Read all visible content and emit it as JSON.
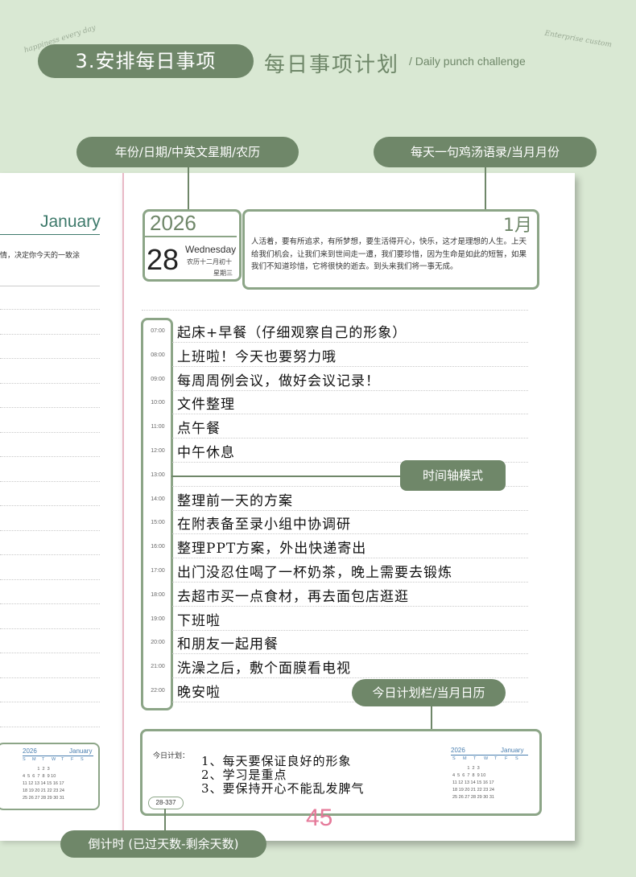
{
  "header": {
    "step_label": "3.安排每日事项",
    "title": "每日事项计划",
    "subtitle": "/ Daily punch challenge",
    "deco_left": "happiness every day",
    "deco_right": "Enterprise custom"
  },
  "callouts": {
    "date_info": "年份/日期/中英文星期/农历",
    "quote_month": "每天一句鸡汤语录/当月月份",
    "timeline": "时间轴模式",
    "plan_calendar": "今日计划栏/当月日历",
    "countdown": "倒计时 (已过天数-剩余天数)"
  },
  "left_page": {
    "month": "January",
    "text_fragment": "情，决定你今天的一致涂",
    "calendar": {
      "year": "2026",
      "month": "January",
      "weekdays": [
        "S",
        "M",
        "T",
        "W",
        "T",
        "F",
        "S"
      ],
      "rows": [
        "            1  2  3",
        "4  5  6  7  8  9 10",
        "11 12 13 14 15 16 17",
        "18 19 20 21 22 23 24",
        "25 26 27 28 29 30 31"
      ]
    }
  },
  "date_block": {
    "year": "2026",
    "day": "28",
    "weekday_en": "Wednesday",
    "lunar": "农历十二月初十",
    "weekday_cn": "星期三"
  },
  "quote_block": {
    "month": "1月",
    "text": "人活着，要有所追求，有所梦想，要生活得开心，快乐，这才是理想的人生。上天给我们机会，让我们来到世间走一遭，我们要珍惜，因为生命是如此的短暂，如果我们不知道珍惜，它将很快的逝去。到头来我们将一事无成。"
  },
  "timeline": [
    {
      "time": "07:00",
      "entry": "起床+早餐（仔细观察自己的形象）"
    },
    {
      "time": "08:00",
      "entry": "上班啦！今天也要努力哦"
    },
    {
      "time": "09:00",
      "entry": "每周周例会议，做好会议记录！"
    },
    {
      "time": "10:00",
      "entry": "文件整理"
    },
    {
      "time": "11:00",
      "entry": "点午餐"
    },
    {
      "time": "12:00",
      "entry": "中午休息"
    },
    {
      "time": "13:00",
      "entry": ""
    },
    {
      "time": "14:00",
      "entry": "整理前一天的方案"
    },
    {
      "time": "15:00",
      "entry": "在附表备至录小组中协调研"
    },
    {
      "time": "16:00",
      "entry": "整理PPT方案，外出快递寄出"
    },
    {
      "time": "17:00",
      "entry": "出门没忍住喝了一杯奶茶，晚上需要去锻炼"
    },
    {
      "time": "18:00",
      "entry": "去超市买一点食材，再去面包店逛逛"
    },
    {
      "time": "19:00",
      "entry": "下班啦"
    },
    {
      "time": "20:00",
      "entry": "和朋友一起用餐"
    },
    {
      "time": "21:00",
      "entry": "洗澡之后，敷个面膜看电视"
    },
    {
      "time": "22:00",
      "entry": "晚安啦"
    }
  ],
  "plan": {
    "label": "今日计划：",
    "items": [
      "1、每天要保证良好的形象",
      "2、学习是重点",
      "3、要保持开心不能乱发脾气"
    ],
    "counter": "28-337"
  },
  "right_calendar": {
    "year": "2026",
    "month": "January",
    "weekdays": [
      "S",
      "M",
      "T",
      "W",
      "T",
      "F",
      "S"
    ],
    "rows": [
      "            1  2  3",
      "4  5  6  7  8  9 10",
      "11 12 13 14 15 16 17",
      "18 19 20 21 22 23 24",
      "25 26 27 28 29 30 31"
    ]
  },
  "page_number": "45",
  "colors": {
    "background": "#d9e8d3",
    "accent": "#6f8769",
    "box_border": "#8ca587",
    "page_number": "#e57a9a"
  }
}
